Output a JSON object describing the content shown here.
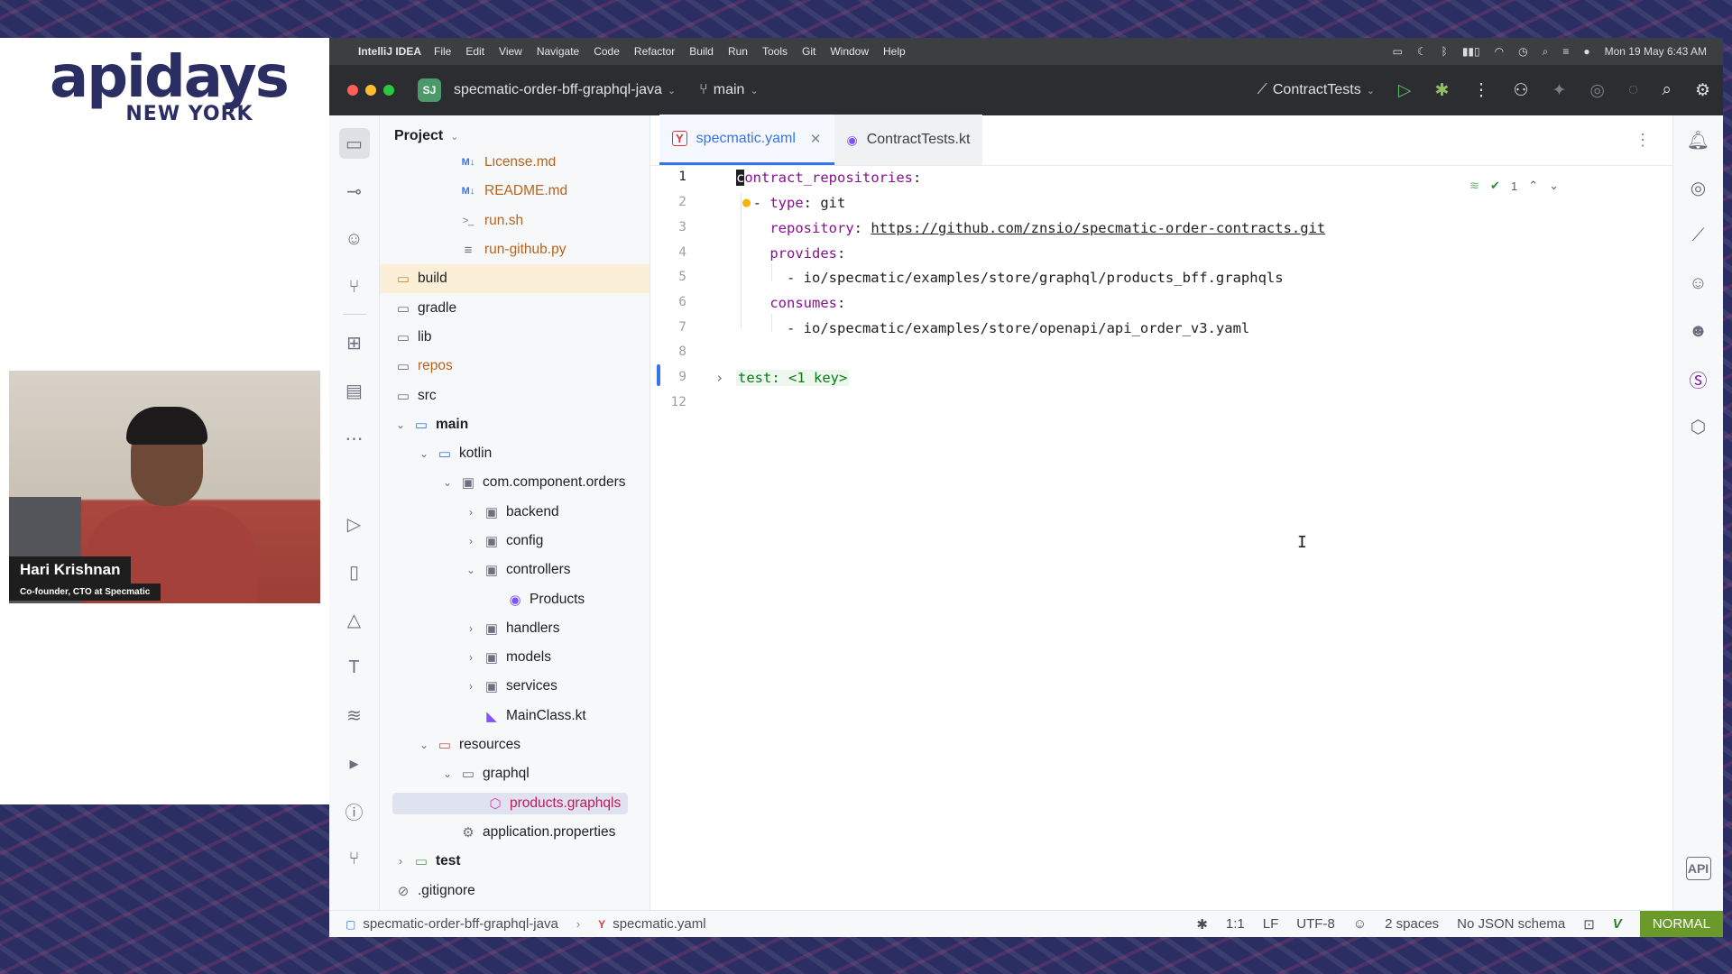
{
  "event": {
    "logo_main": "apidays",
    "logo_sub": "NEW YORK"
  },
  "speaker": {
    "name": "Hari Krishnan",
    "role": "Co-founder, CTO at Specmatic"
  },
  "menubar": {
    "app_name": "IntelliJ IDEA",
    "items": [
      "File",
      "Edit",
      "View",
      "Navigate",
      "Code",
      "Refactor",
      "Build",
      "Run",
      "Tools",
      "Git",
      "Window",
      "Help"
    ],
    "datetime": "Mon 19 May  6:43 AM"
  },
  "toolbar": {
    "project_badge": "SJ",
    "project_name": "specmatic-order-bff-graphql-java",
    "branch": "main",
    "run_config": "ContractTests"
  },
  "project_panel": {
    "title": "Project",
    "tree": [
      {
        "label": "License.md",
        "icon": "markdown-icon",
        "icon_text": "M↓"
      },
      {
        "label": "README.md",
        "icon": "markdown-icon",
        "icon_text": "M↓"
      },
      {
        "label": "run.sh",
        "icon": "shell-script-icon",
        "icon_text": ">_"
      },
      {
        "label": "run-github.py",
        "icon": "text-file-icon",
        "icon_text": "≡"
      },
      {
        "label": "build",
        "icon": "folder-icon"
      },
      {
        "label": "gradle",
        "icon": "folder-icon"
      },
      {
        "label": "lib",
        "icon": "folder-icon"
      },
      {
        "label": "repos",
        "icon": "folder-icon"
      },
      {
        "label": "src",
        "icon": "folder-icon"
      },
      {
        "label": "main",
        "icon": "source-folder-icon"
      },
      {
        "label": "kotlin",
        "icon": "folder-icon"
      },
      {
        "label": "com.component.orders",
        "icon": "package-icon"
      },
      {
        "label": "backend",
        "icon": "package-icon"
      },
      {
        "label": "config",
        "icon": "package-icon"
      },
      {
        "label": "controllers",
        "icon": "package-icon"
      },
      {
        "label": "Products",
        "icon": "kotlin-class-icon"
      },
      {
        "label": "handlers",
        "icon": "package-icon"
      },
      {
        "label": "models",
        "icon": "package-icon"
      },
      {
        "label": "services",
        "icon": "package-icon"
      },
      {
        "label": "MainClass.kt",
        "icon": "kotlin-file-icon"
      },
      {
        "label": "resources",
        "icon": "resources-folder-icon"
      },
      {
        "label": "graphql",
        "icon": "folder-icon"
      },
      {
        "label": "products.graphqls",
        "icon": "graphql-icon"
      },
      {
        "label": "application.properties",
        "icon": "settings-file-icon"
      },
      {
        "label": "test",
        "icon": "test-folder-icon"
      },
      {
        "label": ".gitignore",
        "icon": "ignored-file-icon"
      }
    ]
  },
  "editor": {
    "tabs": [
      {
        "label": "specmatic.yaml",
        "active": true
      },
      {
        "label": "ContractTests.kt",
        "active": false
      }
    ],
    "inspection_count": "1",
    "lines": [
      {
        "num": "1"
      },
      {
        "num": "2",
        "key": "type",
        "value": "git"
      },
      {
        "num": "3",
        "key": "repository",
        "value": "https://github.com/znsio/specmatic-order-contracts.git"
      },
      {
        "num": "4",
        "key": "provides"
      },
      {
        "num": "5",
        "value": "io/specmatic/examples/store/graphql/products_bff.graphqls"
      },
      {
        "num": "6",
        "key": "consumes"
      },
      {
        "num": "7",
        "value": "io/specmatic/examples/store/openapi/api_order_v3.yaml"
      },
      {
        "num": "8"
      },
      {
        "num": "9",
        "key": "test",
        "folded": "<1 key>"
      },
      {
        "num": "12"
      }
    ],
    "line1_key_first": "c",
    "line1_key_rest": "ontract_repositories"
  },
  "status_bar": {
    "project": "specmatic-order-bff-graphql-java",
    "file": "specmatic.yaml",
    "position": "1:1",
    "line_ending": "LF",
    "encoding": "UTF-8",
    "indent": "2 spaces",
    "schema": "No JSON schema",
    "mode": "NORMAL"
  },
  "colors": {
    "accent": "#3574f0",
    "yaml_key": "#871094",
    "mode_badge": "#6a9a2a"
  }
}
